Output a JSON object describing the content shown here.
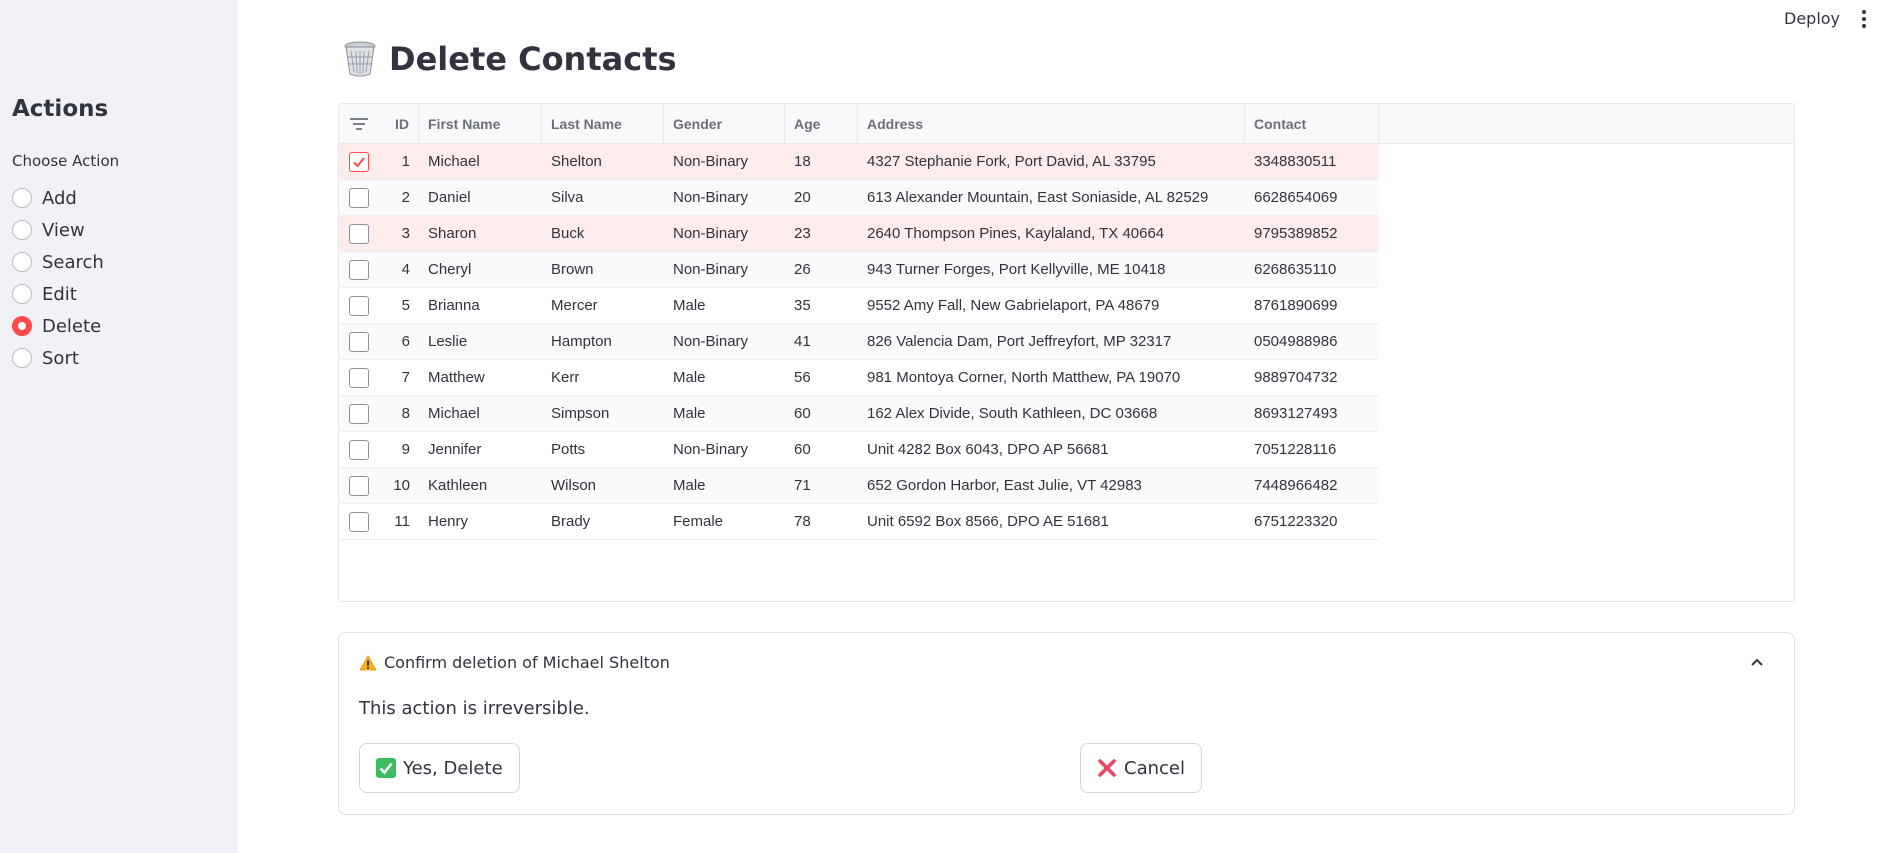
{
  "header": {
    "deploy_label": "Deploy",
    "menu_icon": "kebab-menu-icon"
  },
  "sidebar": {
    "title": "Actions",
    "radio_label": "Choose Action",
    "options": [
      {
        "label": "Add",
        "selected": false
      },
      {
        "label": "View",
        "selected": false
      },
      {
        "label": "Search",
        "selected": false
      },
      {
        "label": "Edit",
        "selected": false
      },
      {
        "label": "Delete",
        "selected": true
      },
      {
        "label": "Sort",
        "selected": false
      }
    ]
  },
  "main": {
    "title": "Delete Contacts",
    "title_icon": "wastebasket-icon"
  },
  "table": {
    "columns": [
      "ID",
      "First Name",
      "Last Name",
      "Gender",
      "Age",
      "Address",
      "Contact"
    ],
    "rows": [
      {
        "checked": true,
        "id": "1",
        "first": "Michael",
        "last": "Shelton",
        "gender": "Non-Binary",
        "age": "18",
        "address": "4327 Stephanie Fork, Port David, AL 33795",
        "contact": "3348830511"
      },
      {
        "checked": false,
        "id": "2",
        "first": "Daniel",
        "last": "Silva",
        "gender": "Non-Binary",
        "age": "20",
        "address": "613 Alexander Mountain, East Soniaside, AL 82529",
        "contact": "6628654069"
      },
      {
        "checked": false,
        "id": "3",
        "first": "Sharon",
        "last": "Buck",
        "gender": "Non-Binary",
        "age": "23",
        "address": "2640 Thompson Pines, Kaylaland, TX 40664",
        "contact": "9795389852"
      },
      {
        "checked": false,
        "id": "4",
        "first": "Cheryl",
        "last": "Brown",
        "gender": "Non-Binary",
        "age": "26",
        "address": "943 Turner Forges, Port Kellyville, ME 10418",
        "contact": "6268635110"
      },
      {
        "checked": false,
        "id": "5",
        "first": "Brianna",
        "last": "Mercer",
        "gender": "Male",
        "age": "35",
        "address": "9552 Amy Fall, New Gabrielaport, PA 48679",
        "contact": "8761890699"
      },
      {
        "checked": false,
        "id": "6",
        "first": "Leslie",
        "last": "Hampton",
        "gender": "Non-Binary",
        "age": "41",
        "address": "826 Valencia Dam, Port Jeffreyfort, MP 32317",
        "contact": "0504988986"
      },
      {
        "checked": false,
        "id": "7",
        "first": "Matthew",
        "last": "Kerr",
        "gender": "Male",
        "age": "56",
        "address": "981 Montoya Corner, North Matthew, PA 19070",
        "contact": "9889704732"
      },
      {
        "checked": false,
        "id": "8",
        "first": "Michael",
        "last": "Simpson",
        "gender": "Male",
        "age": "60",
        "address": "162 Alex Divide, South Kathleen, DC 03668",
        "contact": "8693127493"
      },
      {
        "checked": false,
        "id": "9",
        "first": "Jennifer",
        "last": "Potts",
        "gender": "Non-Binary",
        "age": "60",
        "address": "Unit 4282 Box 6043, DPO AP 56681",
        "contact": "7051228116"
      },
      {
        "checked": false,
        "id": "10",
        "first": "Kathleen",
        "last": "Wilson",
        "gender": "Male",
        "age": "71",
        "address": "652 Gordon Harbor, East Julie, VT 42983",
        "contact": "7448966482"
      },
      {
        "checked": false,
        "id": "11",
        "first": "Henry",
        "last": "Brady",
        "gender": "Female",
        "age": "78",
        "address": "Unit 6592 Box 8566, DPO AE 51681",
        "contact": "6751223320"
      }
    ]
  },
  "confirm": {
    "title": "Confirm deletion of Michael Shelton",
    "message": "This action is irreversible.",
    "yes_label": "Yes, Delete",
    "cancel_label": "Cancel"
  },
  "colors": {
    "accent": "#ff4b4b",
    "sidebar_bg": "#f0f2f6",
    "selected_row": "#fdecec",
    "check_green": "#3dbd5d",
    "cancel_red": "#f0446b"
  }
}
